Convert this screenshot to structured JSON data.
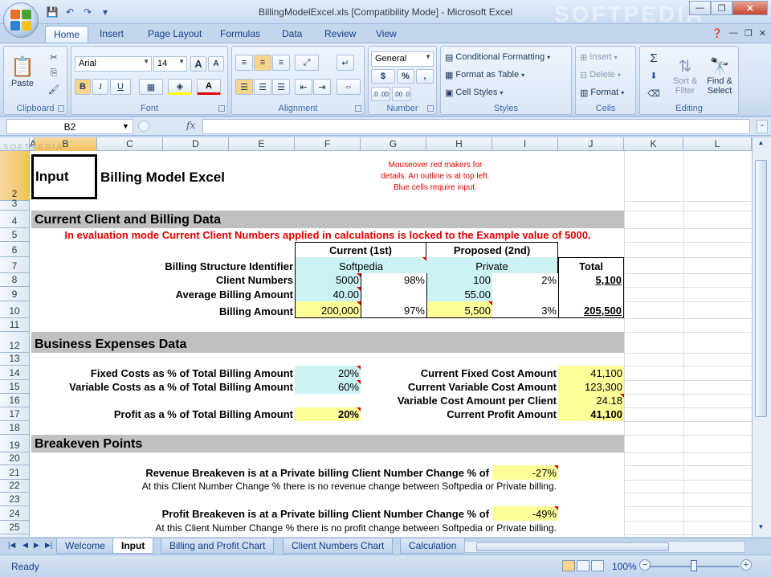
{
  "window": {
    "title": "BillingModelExcel.xls  [Compatibility Mode] - Microsoft Excel",
    "watermark": "SOFTPEDIA",
    "controls": {
      "minimize": "—",
      "restore": "❐",
      "close": "✕"
    }
  },
  "quick_access": [
    "save-icon",
    "undo-icon",
    "redo-icon",
    "customize-icon"
  ],
  "ribbon": {
    "tabs": [
      "Home",
      "Insert",
      "Page Layout",
      "Formulas",
      "Data",
      "Review",
      "View"
    ],
    "active_tab": "Home",
    "groups": {
      "clipboard": {
        "label": "Clipboard",
        "paste": "Paste"
      },
      "font": {
        "label": "Font",
        "font_name": "Arial",
        "font_size": "14",
        "bold": "B",
        "italic": "I",
        "underline": "U",
        "grow": "A",
        "shrink": "A"
      },
      "alignment": {
        "label": "Alignment"
      },
      "number": {
        "label": "Number",
        "format": "General",
        "currency": "$",
        "percent": "%",
        "comma": ",",
        "inc_dec": ".0 .00",
        "dec_dec": ".00 .0"
      },
      "styles": {
        "label": "Styles",
        "cond_format": "Conditional Formatting",
        "format_table": "Format as Table",
        "cell_styles": "Cell Styles"
      },
      "cells": {
        "label": "Cells",
        "insert": "Insert",
        "delete": "Delete",
        "format": "Format"
      },
      "editing": {
        "label": "Editing",
        "sum": "Σ",
        "sort_filter_1": "Sort &",
        "sort_filter_2": "Filter",
        "find_select_1": "Find &",
        "find_select_2": "Select"
      }
    }
  },
  "formula_bar": {
    "name_box": "B2",
    "fx": "fx",
    "content": ""
  },
  "columns": [
    "A",
    "B",
    "C",
    "D",
    "E",
    "F",
    "G",
    "H",
    "I",
    "J",
    "K",
    "L"
  ],
  "selected_column": "B",
  "rows": [
    "2",
    "3",
    "4",
    "5",
    "6",
    "7",
    "8",
    "9",
    "10",
    "11",
    "12",
    "13",
    "14",
    "15",
    "16",
    "17",
    "18",
    "19",
    "20",
    "21",
    "22",
    "23",
    "24",
    "25",
    "26"
  ],
  "selected_row": "2",
  "sheet": {
    "input_label": "Input",
    "title": "Billing Model Excel",
    "note_line1": "Mouseover red makers for",
    "note_line2": "details. An outline is at top left.",
    "note_line3": "Blue cells require input.",
    "section_client": "Current Client and Billing Data",
    "eval_notice": "In evaluation mode Current Client Numbers applied in calculations is locked to the Example value of 5000.",
    "hdr_current": "Current (1st)",
    "hdr_proposed": "Proposed (2nd)",
    "lbl_structure": "Billing Structure Identifier",
    "val_structure_current": "Softpedia",
    "val_structure_proposed": "Private",
    "hdr_total": "Total",
    "lbl_client_numbers": "Client Numbers",
    "client_current": "5000",
    "client_current_pct": "98%",
    "client_proposed": "100",
    "client_proposed_pct": "2%",
    "client_total": "5,100",
    "lbl_avg_billing": "Average Billing Amount",
    "avg_current": "40.00",
    "avg_proposed": "55.00",
    "lbl_billing_amount": "Billing Amount",
    "billing_current": "200,000",
    "billing_current_pct": "97%",
    "billing_proposed": "5,500",
    "billing_proposed_pct": "3%",
    "billing_total": "205,500",
    "section_expenses": "Business Expenses Data",
    "lbl_fixed_pct": "Fixed Costs as % of Total Billing Amount",
    "fixed_pct": "20%",
    "lbl_variable_pct": "Variable Costs as a % of Total Billing Amount",
    "variable_pct": "60%",
    "lbl_profit_pct": "Profit as a % of Total Billing Amount",
    "profit_pct": "20%",
    "lbl_fixed_cost": "Current Fixed Cost Amount",
    "fixed_cost": "41,100",
    "lbl_variable_cost": "Current Variable Cost Amount",
    "variable_cost": "123,300",
    "lbl_variable_per_client": "Variable Cost Amount per Client",
    "variable_per_client": "24.18",
    "lbl_profit_amount": "Current Profit Amount",
    "profit_amount": "41,100",
    "section_breakeven": "Breakeven Points",
    "lbl_revenue_breakeven": "Revenue Breakeven is at a Private billing Client Number Change % of",
    "revenue_breakeven": "-27%",
    "note_revenue": "At this Client Number Change % there is no revenue change between Softpedia or Private billing.",
    "lbl_profit_breakeven": "Profit Breakeven is at a Private billing Client Number Change % of",
    "profit_breakeven": "-49%",
    "note_profit": "At this Client Number Change % there is no profit change between Softpedia or Private billing."
  },
  "sheet_tabs": [
    "Welcome",
    "Input",
    "Billing and Profit Chart",
    "Client Numbers Chart",
    "Calculation"
  ],
  "active_sheet": "Input",
  "status": {
    "ready": "Ready",
    "zoom": "100%"
  },
  "colors": {
    "input_cyan": "#ccf3f4",
    "calc_yellow": "#ffff99",
    "section_gray": "#c0c0c0",
    "notice_red": "#e50000"
  }
}
